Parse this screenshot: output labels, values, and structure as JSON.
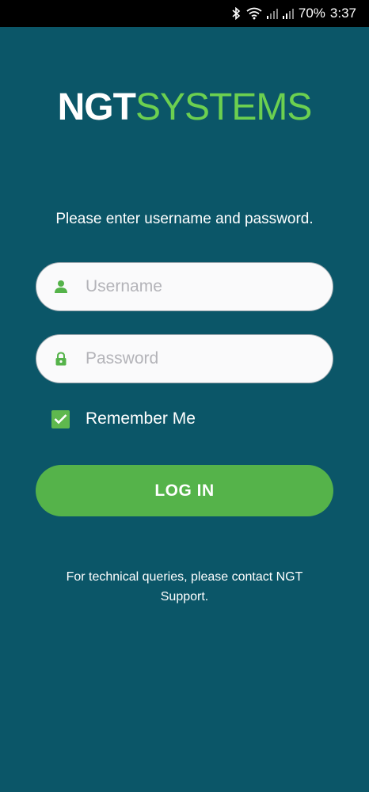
{
  "status_bar": {
    "battery": "70%",
    "time": "3:37"
  },
  "logo": {
    "bold_part": "NGT",
    "light_part": "SYSTEMS"
  },
  "instruction": "Please enter username and password.",
  "username": {
    "placeholder": "Username",
    "value": ""
  },
  "password": {
    "placeholder": "Password",
    "value": ""
  },
  "remember_me": {
    "label": "Remember Me",
    "checked": true
  },
  "login_button": {
    "label": "LOG IN"
  },
  "footer_note": "For technical queries, please contact NGT Support.",
  "colors": {
    "background": "#0b5668",
    "accent_green": "#55b34a",
    "logo_green": "#6cd050"
  },
  "icons": {
    "username": "person-icon",
    "password": "lock-icon",
    "checkbox": "checkmark-icon"
  }
}
